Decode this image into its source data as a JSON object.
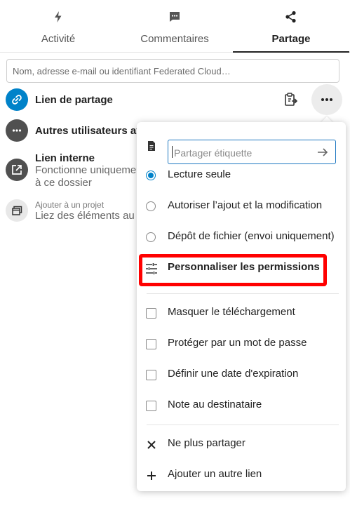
{
  "tabs": [
    {
      "label": "Activité",
      "icon": "activity-icon",
      "active": false
    },
    {
      "label": "Commentaires",
      "icon": "comment-icon",
      "active": false
    },
    {
      "label": "Partage",
      "icon": "share-icon",
      "active": true
    }
  ],
  "search": {
    "placeholder": "Nom, adresse e-mail ou identifiant Federated Cloud…"
  },
  "shares": {
    "share_link": {
      "title": "Lien de partage",
      "icon": "link-icon",
      "avatar_color": "#0082c9"
    },
    "others": {
      "title": "Autres utilisateurs ayant",
      "icon": "more-icon",
      "avatar_color": "#505050"
    },
    "internal_link": {
      "title": "Lien interne",
      "subtitle_line1": "Fonctionne uniquement",
      "subtitle_line2": "à ce dossier",
      "icon": "external-link-icon",
      "avatar_color": "#505050"
    },
    "project": {
      "small": "Ajouter à un projet",
      "subtitle": "Liez des éléments au",
      "icon": "project-icon",
      "avatar_color": "#e8e8e8"
    }
  },
  "menu": {
    "label_placeholder": "Partager étiquette",
    "permissions": [
      {
        "label": "Lecture seule",
        "selected": true
      },
      {
        "label": "Autoriser l’ajout et la modification",
        "selected": false
      },
      {
        "label": "Dépôt de fichier (envoi uniquement)",
        "selected": false
      }
    ],
    "custom_permissions": "Personnaliser les permissions",
    "options": [
      {
        "label": "Masquer le téléchargement",
        "checked": false
      },
      {
        "label": "Protéger par un mot de passe",
        "checked": false
      },
      {
        "label": "Définir une date d'expiration",
        "checked": false
      },
      {
        "label": "Note au destinataire",
        "checked": false
      }
    ],
    "unshare": "Ne plus partager",
    "add_link": "Ajouter un autre lien"
  },
  "colors": {
    "accent": "#0082c9",
    "highlight": "#ff0000"
  }
}
